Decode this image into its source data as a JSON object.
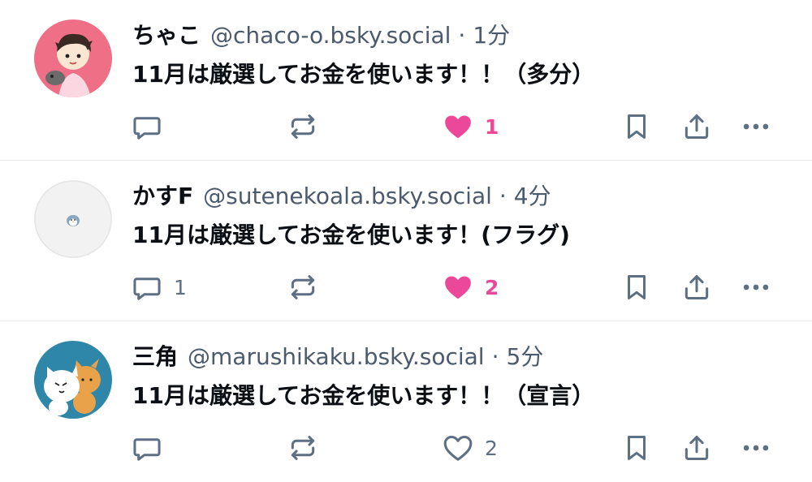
{
  "posts": [
    {
      "name": "ちゃこ",
      "handle": "@chaco-o.bsky.social",
      "separator": "·",
      "time": "1分",
      "text": "11月は厳選してお金を使います！！（多分）",
      "reply_count": "",
      "like_count": "1",
      "liked": true,
      "avatar_icon": "avatar-chaco-icon"
    },
    {
      "name": "かすF",
      "handle": "@sutenekoala.bsky.social",
      "separator": "·",
      "time": "4分",
      "text": "11月は厳選してお金を使います！(フラグ)",
      "reply_count": "1",
      "like_count": "2",
      "liked": true,
      "avatar_icon": "avatar-penguin-icon"
    },
    {
      "name": "三角",
      "handle": "@marushikaku.bsky.social",
      "separator": "·",
      "time": "5分",
      "text": "11月は厳選してお金を使います！！（宣言）",
      "reply_count": "",
      "like_count": "2",
      "liked": false,
      "avatar_icon": "avatar-cats-icon"
    }
  ],
  "colors": {
    "icon": "#5d6f83",
    "liked": "#ec4899",
    "muted_text": "#4b5a6c",
    "divider": "#e6e9ee"
  }
}
